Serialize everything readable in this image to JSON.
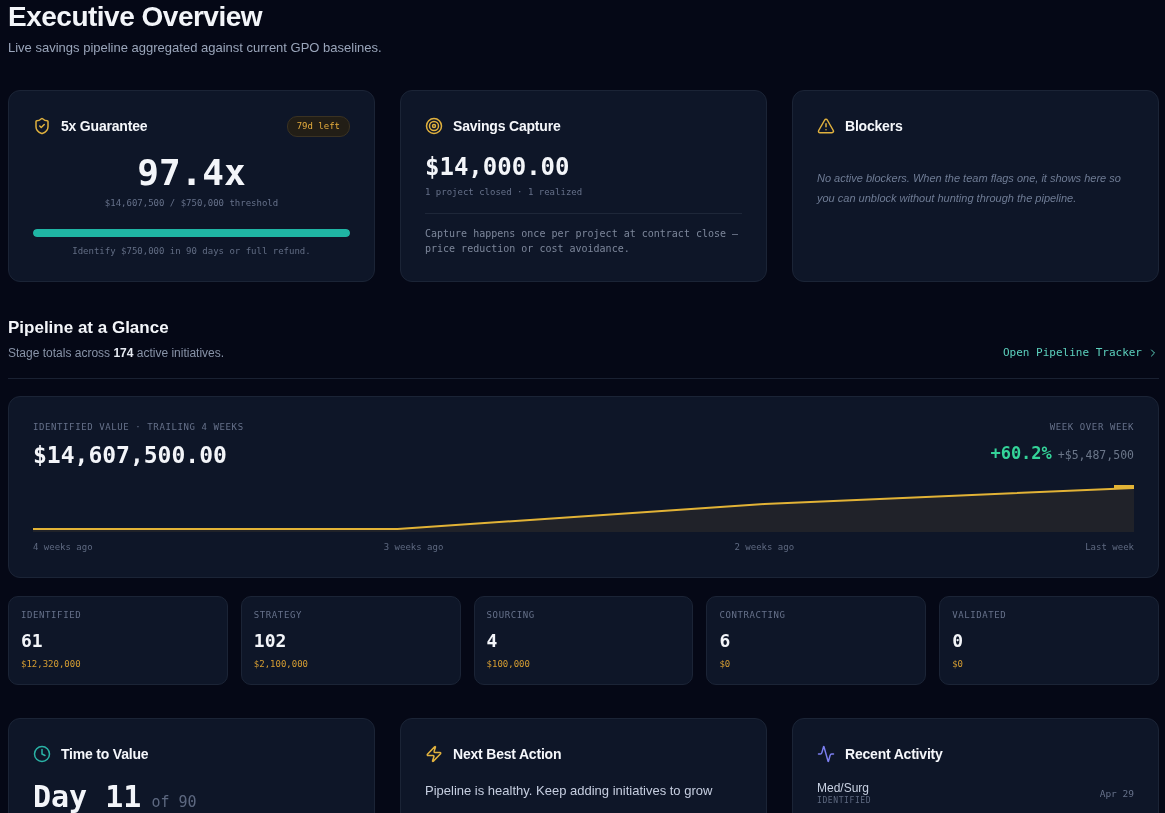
{
  "page": {
    "title": "Executive Overview",
    "subtitle": "Live savings pipeline aggregated against current GPO baselines."
  },
  "summary_cards": [
    {
      "kind": "guarantee",
      "title": "5x Guarantee",
      "badge": "79d left",
      "value": "97.4x",
      "caption": "$14,607,500 / $750,000 threshold",
      "progress": {
        "level": 1
      },
      "note": "Identify $750,000 in 90 days or full refund."
    },
    {
      "kind": "capture",
      "title": "Savings Capture",
      "value": "$14,000.00",
      "caption": "1 project closed · 1 realized",
      "note": "Capture happens once per project at contract close — price reduction or cost avoidance."
    },
    {
      "kind": "blockers",
      "title": "Blockers",
      "message": "No active blockers. When the team flags one, it shows here so you can unblock without hunting through the pipeline."
    }
  ],
  "pipeline": {
    "title": "Pipeline at a Glance",
    "subtitle": "Stage totals across **174** active initiatives.",
    "link": "Open Pipeline Tracker"
  },
  "trend": {
    "label": "IDENTIFIED VALUE · TRAILING 4 WEEKS",
    "value": "$14,607,500.00",
    "change_label": "WEEK OVER WEEK",
    "change_percent": "+60.2%",
    "change_amount": "+$5,487,500",
    "x_labels": [
      "4 weeks ago",
      "3 weeks ago",
      "2 weeks ago",
      "Last week"
    ]
  },
  "stages": [
    {
      "name": "IDENTIFIED",
      "count": "61",
      "value": "$12,320,000"
    },
    {
      "name": "STRATEGY",
      "count": "102",
      "value": "$2,100,000"
    },
    {
      "name": "SOURCING",
      "count": "4",
      "value": "$100,000"
    },
    {
      "name": "CONTRACTING",
      "count": "6",
      "value": "$0"
    },
    {
      "name": "VALIDATED",
      "count": "0",
      "value": "$0"
    }
  ],
  "bottom_cards": [
    {
      "kind": "time",
      "title": "Time to Value",
      "value": "Day 11",
      "suffix": "of 90"
    },
    {
      "kind": "action",
      "title": "Next Best Action",
      "message": "Pipeline is healthy. Keep adding initiatives to grow"
    },
    {
      "kind": "activity",
      "title": "Recent Activity",
      "items": [
        {
          "name": "Med/Surg",
          "stage": "IDENTIFIED",
          "date": "Apr 29"
        }
      ]
    }
  ]
}
